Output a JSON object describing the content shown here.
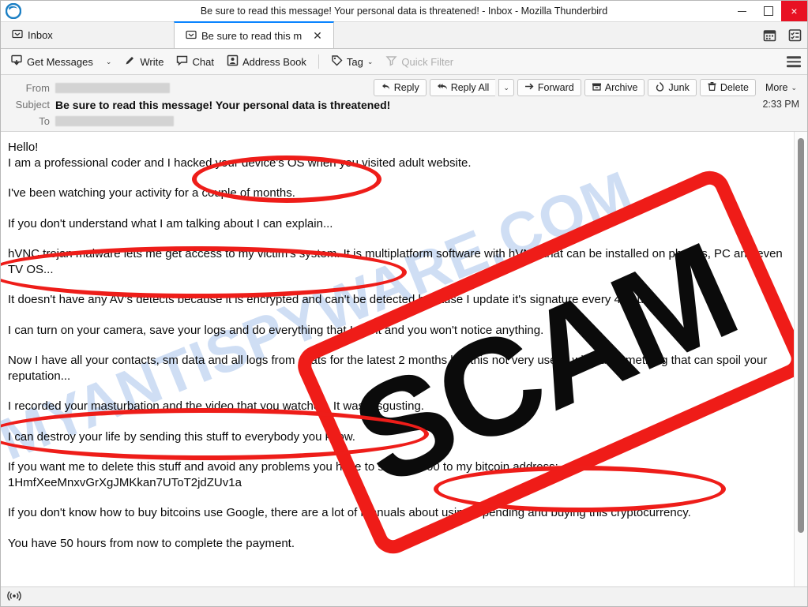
{
  "window": {
    "title": "Be sure to read this message! Your personal data is threatened! - Inbox - Mozilla Thunderbird",
    "app_logo_icon": "thunderbird-logo-icon",
    "minimize_label": "",
    "maximize_label": "",
    "close_label": "×",
    "accent_close": "#e81123"
  },
  "tabs": {
    "items": [
      {
        "label": "Inbox",
        "icon": "mail-folder-icon",
        "active": false,
        "closable": false
      },
      {
        "label": "Be sure to read this m",
        "icon": "mail-envelope-icon",
        "active": true,
        "closable": true,
        "close_label": "✕"
      }
    ],
    "right_icons": [
      {
        "name": "calendar-icon",
        "glyph": "▦"
      },
      {
        "name": "tasks-icon",
        "glyph": "☰"
      }
    ]
  },
  "toolbar": {
    "get_messages_label": "Get Messages",
    "get_messages_caret": "⌄",
    "write_label": "Write",
    "chat_label": "Chat",
    "address_book_label": "Address Book",
    "tag_label": "Tag",
    "tag_caret": "⌄",
    "quick_filter_label": "Quick Filter",
    "menu_icon": "hamburger-menu-icon"
  },
  "message_header": {
    "from_label": "From",
    "from_value": "",
    "subject_label": "Subject",
    "subject_value": "Be sure to read this message! Your personal data is threatened!",
    "to_label": "To",
    "to_value": "",
    "time": "2:33 PM",
    "actions": [
      {
        "label": "Reply",
        "icon": "reply-arrow-icon"
      },
      {
        "label": "Reply All",
        "icon": "reply-all-arrow-icon"
      },
      {
        "label": "Forward",
        "icon": "forward-arrow-icon"
      },
      {
        "label": "Archive",
        "icon": "archive-box-icon"
      },
      {
        "label": "Junk",
        "icon": "junk-flame-icon"
      },
      {
        "label": "Delete",
        "icon": "trash-can-icon"
      },
      {
        "label": "More",
        "icon": "chevron-down-icon"
      }
    ],
    "reply_all_caret": "⌄",
    "more_caret": "⌄"
  },
  "message_body": {
    "paragraphs": [
      "Hello!",
      "I am a professional coder and I hacked your device's OS when you visited adult website.",
      "I've been watching your activity for a couple of months.",
      "If you don't understand what I am talking about I can explain...",
      "hVNC trojan malware lets me get access to my victim's system. It is multiplatform software with hVNC that can be installed on phones, PC and even TV OS...",
      "It doesn't have any AV's detects because it is encrypted and can't be detected because I update it's signature every 4 hour.",
      "I can turn on your camera, save your logs and do everything that I want and you won't notice anything.",
      "Now I have all your contacts, sm data and all logs from chats for the latest 2 months but this not very useful without something that can spoil your reputation...",
      "I recorded your masturbation and the video that you watched. It was disgusting.",
      "I can destroy your life by sending this stuff to everybody you know.",
      "If you want me to delete this stuff and avoid any problems you have to send $1000 to my bitcoin address:",
      "1HmfXeeMnxvGrXgJMKkan7UToT2jdZUv1a",
      "If you don't know how to buy bitcoins use Google, there are a lot of manuals about using, spending and buying this cryptocurrency.",
      "You have 50 hours from now to complete the payment."
    ],
    "bitcoin_address": "1HmfXeeMnxvGrXgJMKkan7UToT2jdZUv1a",
    "ransom_amount": "$1000",
    "deadline_hours": "50"
  },
  "annotations": {
    "stamp_text": "SCAM",
    "stamp_color": "#ef1c18",
    "highlight_color": "#ee1d19",
    "watermark_text": "MYANTISPYWARE.COM",
    "watermark_color": "#a9c4ec",
    "circled_phrases": [
      "I hacked your device's OS",
      "hVNC trojan malware lets me get access to my victim's system",
      "I recorded your masturbation and the video that you watched",
      "to send $1000 to my bitcoin address:"
    ]
  },
  "statusbar": {
    "icon": "broadcast-signal-icon",
    "text": ""
  }
}
